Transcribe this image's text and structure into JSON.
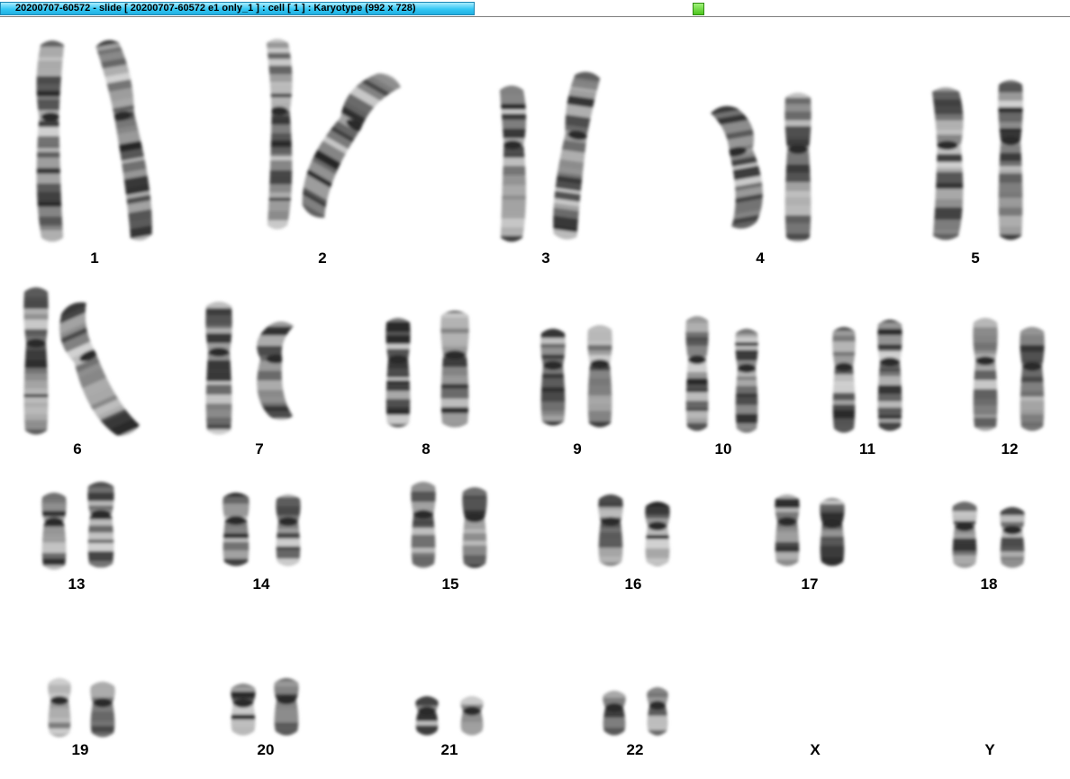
{
  "window": {
    "title": "20200707-60572 - slide [ 20200707-60572 e1 only_1 ] : cell [ 1 ] : Karyotype  (992 x 728)",
    "status_color": "#5cd82a",
    "tab_color": "#34c8f4"
  },
  "karyotype": {
    "labels": [
      "1",
      "2",
      "3",
      "4",
      "5",
      "6",
      "7",
      "8",
      "9",
      "10",
      "11",
      "12",
      "13",
      "14",
      "15",
      "16",
      "17",
      "18",
      "19",
      "20",
      "21",
      "22",
      "X",
      "Y"
    ]
  }
}
